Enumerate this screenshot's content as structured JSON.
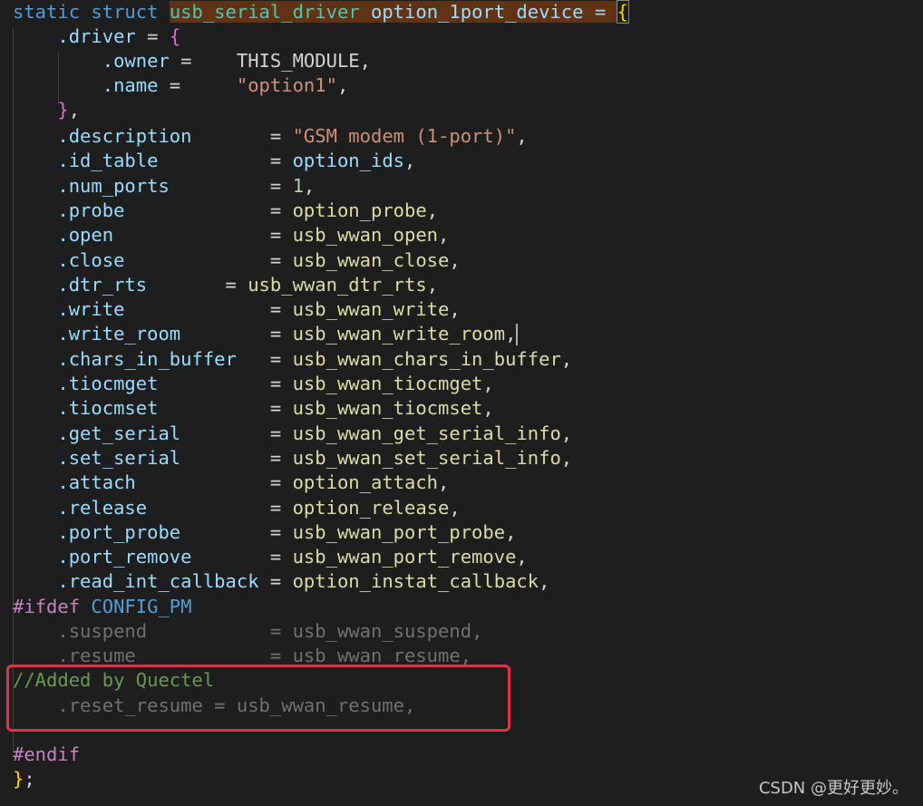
{
  "code": {
    "line1": {
      "static": "static",
      "struct": "struct",
      "type": "usb_serial_driver",
      "name": "option_1port_device",
      "eq": " = ",
      "brace": "{"
    },
    "line2": {
      "field": ".driver",
      "eq": " = ",
      "brace": "{"
    },
    "line3": {
      "field": ".owner",
      "eq": " =    ",
      "value": "THIS_MODULE",
      "comma": ","
    },
    "line4": {
      "field": ".name",
      "eq": " =     ",
      "value": "\"option1\"",
      "comma": ","
    },
    "line5": {
      "brace": "}",
      "comma": ","
    },
    "assignments": [
      {
        "field": ".description",
        "pad": "       ",
        "value": "\"GSM modem (1-port)\"",
        "kind": "str"
      },
      {
        "field": ".id_table",
        "pad": "          ",
        "value": "option_ids",
        "kind": "var"
      },
      {
        "field": ".num_ports",
        "pad": "         ",
        "value": "1",
        "kind": "num"
      },
      {
        "field": ".probe",
        "pad": "             ",
        "value": "option_probe",
        "kind": "fn"
      },
      {
        "field": ".open",
        "pad": "              ",
        "value": "usb_wwan_open",
        "kind": "fn"
      },
      {
        "field": ".close",
        "pad": "             ",
        "value": "usb_wwan_close",
        "kind": "fn"
      },
      {
        "field": ".dtr_rts",
        "pad": "       ",
        "value": "usb_wwan_dtr_rts",
        "kind": "fn"
      },
      {
        "field": ".write",
        "pad": "             ",
        "value": "usb_wwan_write",
        "kind": "fn"
      },
      {
        "field": ".write_room",
        "pad": "        ",
        "value": "usb_wwan_write_room",
        "kind": "fn"
      },
      {
        "field": ".chars_in_buffer",
        "pad": "   ",
        "value": "usb_wwan_chars_in_buffer",
        "kind": "fn"
      },
      {
        "field": ".tiocmget",
        "pad": "          ",
        "value": "usb_wwan_tiocmget",
        "kind": "fn"
      },
      {
        "field": ".tiocmset",
        "pad": "          ",
        "value": "usb_wwan_tiocmset",
        "kind": "fn"
      },
      {
        "field": ".get_serial",
        "pad": "        ",
        "value": "usb_wwan_get_serial_info",
        "kind": "fn"
      },
      {
        "field": ".set_serial",
        "pad": "        ",
        "value": "usb_wwan_set_serial_info",
        "kind": "fn"
      },
      {
        "field": ".attach",
        "pad": "            ",
        "value": "option_attach",
        "kind": "fn"
      },
      {
        "field": ".release",
        "pad": "           ",
        "value": "option_release",
        "kind": "fn"
      },
      {
        "field": ".port_probe",
        "pad": "        ",
        "value": "usb_wwan_port_probe",
        "kind": "fn"
      },
      {
        "field": ".port_remove",
        "pad": "       ",
        "value": "usb_wwan_port_remove",
        "kind": "fn"
      },
      {
        "field": ".read_int_callback",
        "pad": " ",
        "value": "option_instat_callback",
        "kind": "fn"
      }
    ],
    "ifdef": {
      "directive": "#ifdef",
      "macro": "CONFIG_PM"
    },
    "suspend": {
      "field": ".suspend",
      "pad": "           ",
      "value": "usb_wwan_suspend"
    },
    "resume": {
      "field": ".resume",
      "pad": "            ",
      "value": "usb_wwan_resume"
    },
    "comment": "//Added by Quectel",
    "reset_resume": {
      "field": ".reset_resume",
      "eq": " = ",
      "value": "usb_wwan_resume"
    },
    "endif": "#endif",
    "close": {
      "brace": "}",
      "semi": ";"
    }
  },
  "watermark": "CSDN @更好更妙。",
  "colors": {
    "background": "#1e1e1e",
    "highlight_box": "#e8304b"
  }
}
